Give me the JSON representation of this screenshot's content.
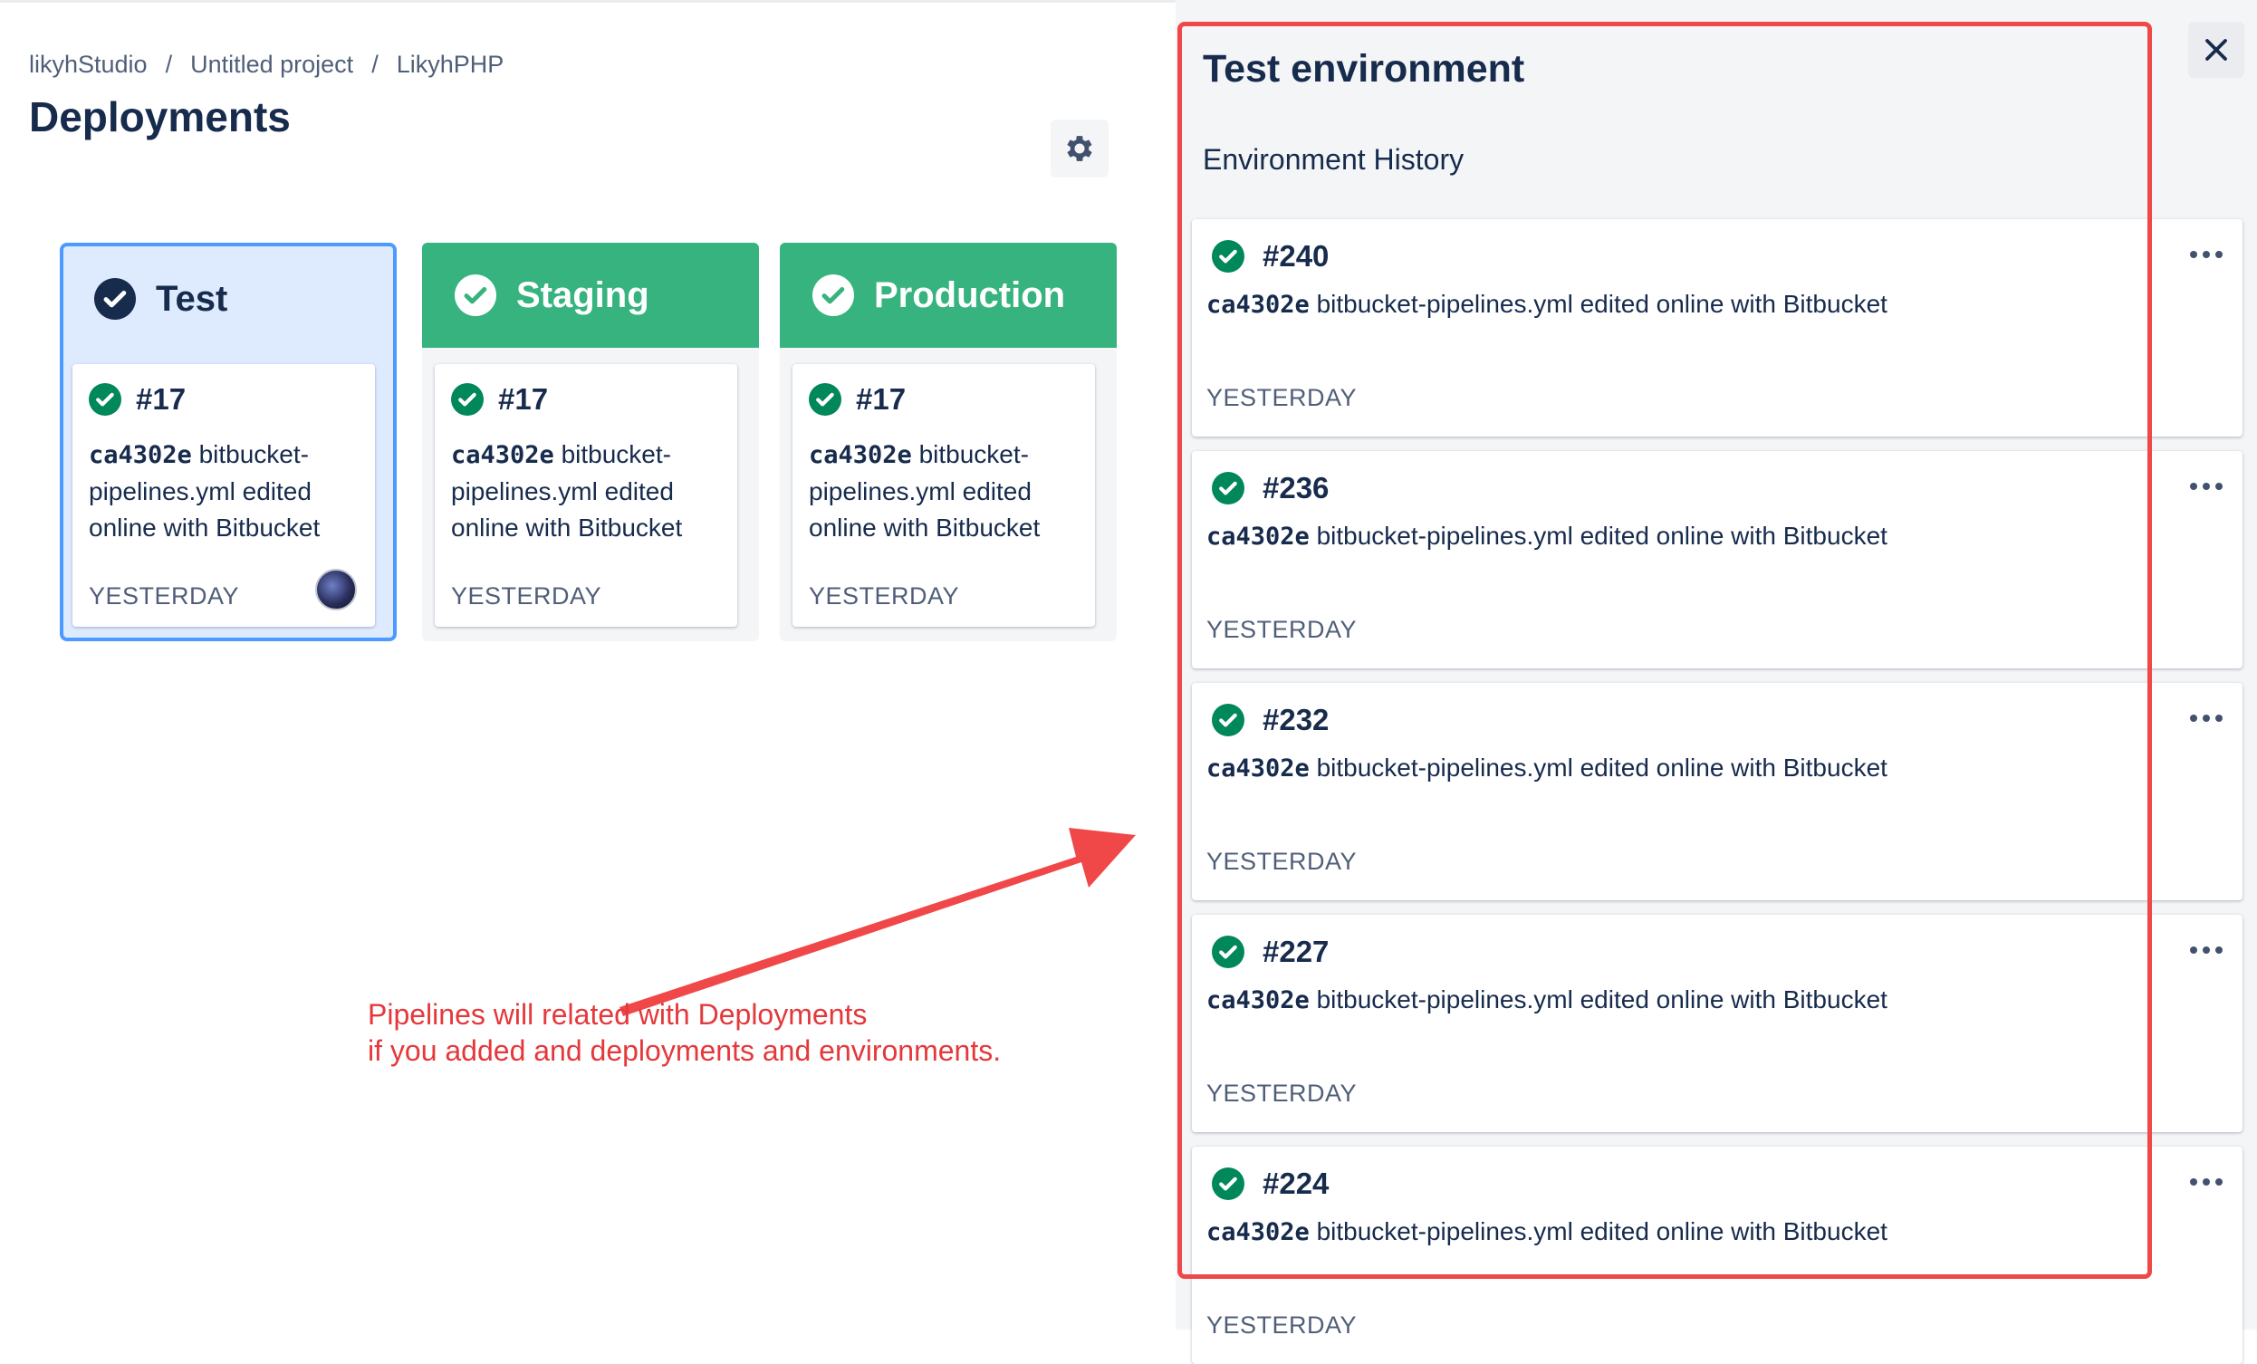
{
  "breadcrumb": [
    "likyhStudio",
    "Untitled project",
    "LikyhPHP"
  ],
  "breadcrumb_separator": "/",
  "page_title": "Deployments",
  "environments": [
    {
      "name": "Test",
      "state": "selected",
      "deploy_number": "#17",
      "hash": "ca4302e",
      "message": "bitbucket-pipelines.yml edited online with Bitbucket",
      "time": "YESTERDAY",
      "has_avatar": true
    },
    {
      "name": "Staging",
      "state": "success",
      "deploy_number": "#17",
      "hash": "ca4302e",
      "message": "bitbucket-pipelines.yml edited online with Bitbucket",
      "time": "YESTERDAY",
      "has_avatar": false
    },
    {
      "name": "Production",
      "state": "success",
      "deploy_number": "#17",
      "hash": "ca4302e",
      "message": "bitbucket-pipelines.yml edited online with Bitbucket",
      "time": "YESTERDAY",
      "has_avatar": false
    }
  ],
  "annotation": {
    "lines": [
      "Pipelines will related with Deployments",
      "if you added and deployments and environments."
    ],
    "color": "#e5383b"
  },
  "panel": {
    "title": "Test environment",
    "subtitle": "Environment History",
    "history": [
      {
        "number": "#240",
        "hash": "ca4302e",
        "message": "bitbucket-pipelines.yml edited online with Bitbucket",
        "time": "YESTERDAY"
      },
      {
        "number": "#236",
        "hash": "ca4302e",
        "message": "bitbucket-pipelines.yml edited online with Bitbucket",
        "time": "YESTERDAY"
      },
      {
        "number": "#232",
        "hash": "ca4302e",
        "message": "bitbucket-pipelines.yml edited online with Bitbucket",
        "time": "YESTERDAY"
      },
      {
        "number": "#227",
        "hash": "ca4302e",
        "message": "bitbucket-pipelines.yml edited online with Bitbucket",
        "time": "YESTERDAY"
      },
      {
        "number": "#224",
        "hash": "ca4302e",
        "message": "bitbucket-pipelines.yml edited online with Bitbucket",
        "time": "YESTERDAY"
      }
    ]
  },
  "icons": {
    "settings": "gear-icon",
    "close": "close-icon",
    "more": "more-icon",
    "status": "check-circle-icon"
  },
  "colors": {
    "success": "#36b37e",
    "success_dark": "#00875a",
    "selected_bg": "#deebff",
    "selected_border": "#4c9aff",
    "highlight_frame": "#f04848"
  }
}
